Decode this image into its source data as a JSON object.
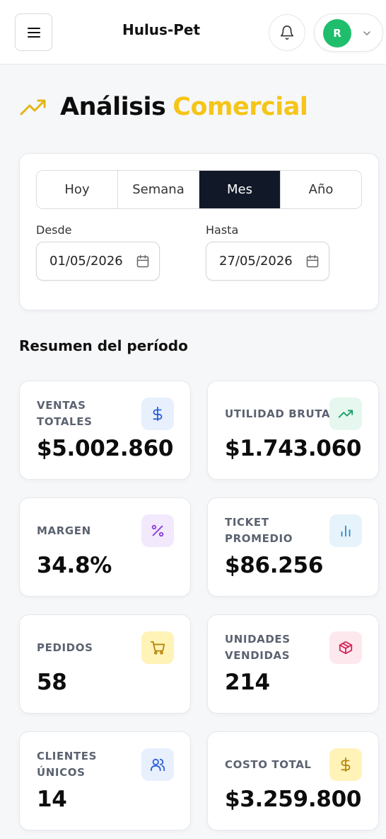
{
  "header": {
    "brand": "Hulus-Pet",
    "avatar_initial": "R",
    "icons": {
      "menu": "menu-icon",
      "bell": "bell-icon",
      "chevron": "chevron-down-icon"
    }
  },
  "page": {
    "title_part1": "Análisis",
    "title_part2": "Comercial",
    "title_icon": "trending-up-icon",
    "accent_color": "#f5c518"
  },
  "filters": {
    "periods": [
      "Hoy",
      "Semana",
      "Mes",
      "Año"
    ],
    "selected_period": "Mes",
    "from_label": "Desde",
    "from_value": "01/05/2026",
    "to_label": "Hasta",
    "to_value": "27/05/2026"
  },
  "summary": {
    "title": "Resumen del período",
    "kpis": [
      {
        "label": "VENTAS TOTALES",
        "value": "$5.002.860",
        "icon": "dollar-icon",
        "icon_color": "#2b5fd9",
        "icon_bg": "#e8f0fe"
      },
      {
        "label": "UTILIDAD BRUTA",
        "value": "$1.743.060",
        "icon": "trending-up-icon",
        "icon_color": "#14a06a",
        "icon_bg": "#e5f7ee"
      },
      {
        "label": "MARGEN",
        "value": "34.8%",
        "icon": "percent-icon",
        "icon_color": "#8a3ddf",
        "icon_bg": "#f2e9fd"
      },
      {
        "label": "TICKET PROMEDIO",
        "value": "$86.256",
        "icon": "bar-chart-icon",
        "icon_color": "#2a8ccf",
        "icon_bg": "#e7f3fb"
      },
      {
        "label": "PEDIDOS",
        "value": "58",
        "icon": "cart-icon",
        "icon_color": "#b8860b",
        "icon_bg": "#fff3b8"
      },
      {
        "label": "UNIDADES VENDIDAS",
        "value": "214",
        "icon": "package-icon",
        "icon_color": "#d1285a",
        "icon_bg": "#fde8ee"
      },
      {
        "label": "CLIENTES ÚNICOS",
        "value": "14",
        "icon": "users-icon",
        "icon_color": "#2b5fd9",
        "icon_bg": "#e8f0fe"
      },
      {
        "label": "COSTO TOTAL",
        "value": "$3.259.800",
        "icon": "dollar-icon",
        "icon_color": "#b8860b",
        "icon_bg": "#fff3b8"
      }
    ]
  }
}
